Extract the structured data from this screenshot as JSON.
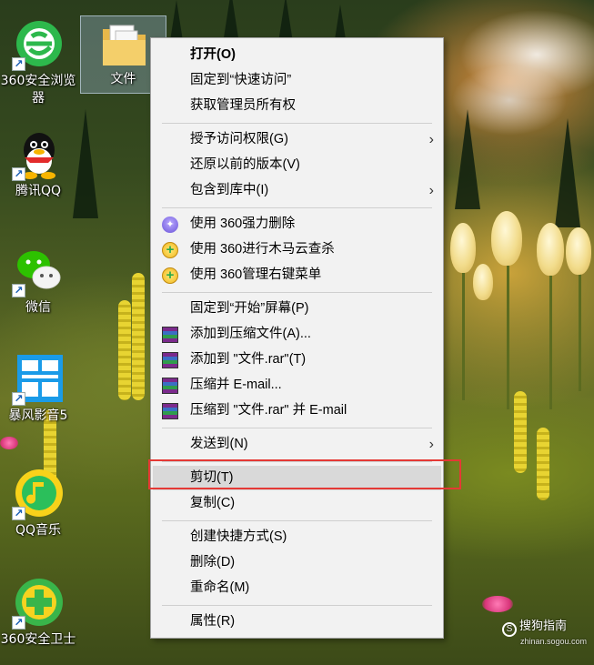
{
  "desktop": {
    "icons": [
      {
        "label": "360安全浏览器",
        "icon": "360-browser-icon"
      },
      {
        "label": "文件",
        "icon": "folder-icon"
      },
      {
        "label": "腾讯QQ",
        "icon": "qq-penguin-icon"
      },
      {
        "label": "微信",
        "icon": "wechat-icon"
      },
      {
        "label": "暴风影音5",
        "icon": "baofeng-player-icon"
      },
      {
        "label": "QQ音乐",
        "icon": "qq-music-icon"
      },
      {
        "label": "360安全卫士",
        "icon": "360-security-icon"
      }
    ]
  },
  "context_menu": {
    "items": [
      {
        "label": "打开(O)",
        "bold": true
      },
      {
        "label": "固定到“快速访问”"
      },
      {
        "label": "获取管理员所有权"
      },
      {
        "label": "授予访问权限(G)",
        "submenu": true
      },
      {
        "label": "还原以前的版本(V)"
      },
      {
        "label": "包含到库中(I)",
        "submenu": true
      },
      {
        "label": "使用 360强力删除",
        "icon": "360-shredder-icon"
      },
      {
        "label": "使用 360进行木马云查杀",
        "icon": "360-plus-icon"
      },
      {
        "label": "使用 360管理右键菜单",
        "icon": "360-plus-icon"
      },
      {
        "label": "固定到“开始”屏幕(P)"
      },
      {
        "label": "添加到压缩文件(A)...",
        "icon": "winrar-icon"
      },
      {
        "label": "添加到 \"文件.rar\"(T)",
        "icon": "winrar-icon"
      },
      {
        "label": "压缩并 E-mail...",
        "icon": "winrar-icon"
      },
      {
        "label": "压缩到 \"文件.rar\" 并 E-mail",
        "icon": "winrar-icon"
      },
      {
        "label": "发送到(N)",
        "submenu": true
      },
      {
        "label": "剪切(T)",
        "highlighted": true
      },
      {
        "label": "复制(C)"
      },
      {
        "label": "创建快捷方式(S)"
      },
      {
        "label": "删除(D)"
      },
      {
        "label": "重命名(M)"
      },
      {
        "label": "属性(R)"
      }
    ],
    "submenu_arrow": "›",
    "highlight_color": "#e53935"
  },
  "watermark": {
    "text": "搜狗指南",
    "sub": "zhinan.sogou.com",
    "logo": "S"
  }
}
